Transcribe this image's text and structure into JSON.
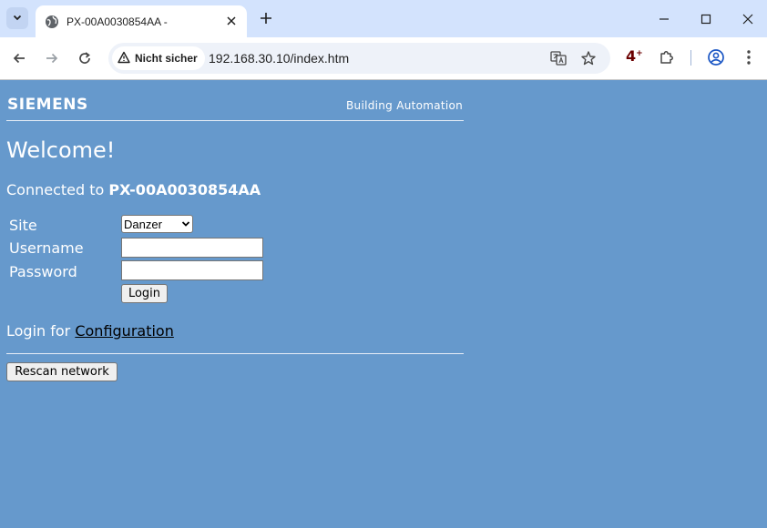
{
  "browser": {
    "tab_title": "PX-00A0030854AA -",
    "security_label": "Nicht sicher",
    "url": "192.168.30.10/index.htm",
    "extension_badge": "4",
    "extension_badge_sup": "+"
  },
  "header": {
    "logo": "SIEMENS",
    "tagline": "Building Automation"
  },
  "main": {
    "welcome": "Welcome!",
    "connected_prefix": "Connected to",
    "device_name": "PX-00A0030854AA",
    "form": {
      "site_label": "Site",
      "site_selected": "Danzer",
      "username_label": "Username",
      "username_value": "",
      "password_label": "Password",
      "password_value": "",
      "login_button": "Login"
    },
    "login_for_prefix": "Login for",
    "configuration_link": "Configuration",
    "rescan_button": "Rescan network"
  },
  "colors": {
    "page_background": "#6699cc",
    "tabbar_background": "#d3e3fd"
  }
}
